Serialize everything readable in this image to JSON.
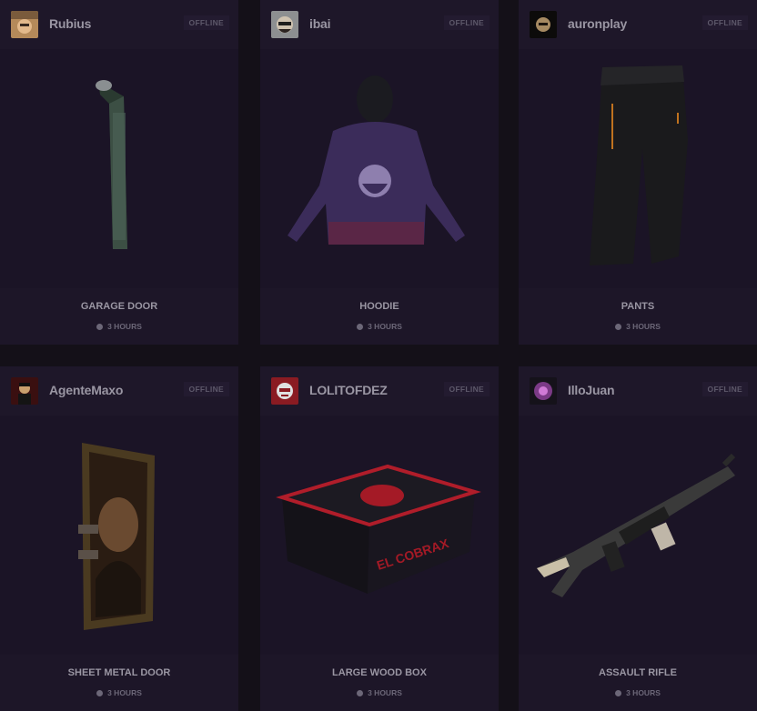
{
  "drops": [
    {
      "streamer": "Rubius",
      "status": "OFFLINE",
      "item": "GARAGE DOOR",
      "duration": "3 HOURS"
    },
    {
      "streamer": "ibai",
      "status": "OFFLINE",
      "item": "HOODIE",
      "duration": "3 HOURS"
    },
    {
      "streamer": "auronplay",
      "status": "OFFLINE",
      "item": "PANTS",
      "duration": "3 HOURS"
    },
    {
      "streamer": "AgenteMaxo",
      "status": "OFFLINE",
      "item": "SHEET METAL DOOR",
      "duration": "3 HOURS"
    },
    {
      "streamer": "LOLITOFDEZ",
      "status": "OFFLINE",
      "item": "LARGE WOOD BOX",
      "duration": "3 HOURS"
    },
    {
      "streamer": "IlloJuan",
      "status": "OFFLINE",
      "item": "ASSAULT RIFLE",
      "duration": "3 HOURS"
    }
  ],
  "colors": {
    "page_bg": "#141018",
    "card_bg": "#1b1426",
    "text": "#9a96a3",
    "muted": "#6c6778"
  },
  "icons": {
    "timer": "clock-icon",
    "avatar": "avatar-image"
  }
}
